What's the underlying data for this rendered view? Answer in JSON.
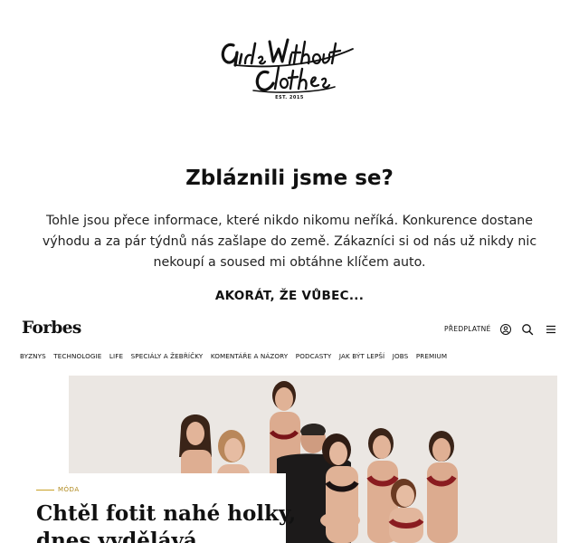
{
  "brand": {
    "logo_text_line1": "Girls Without",
    "logo_text_line2": "Clothes",
    "logo_est": "EST. 2015"
  },
  "intro": {
    "headline": "Zbláznili jsme se?",
    "body": "Tohle jsou přece informace, které nikdo nikomu neříká. Konkurence dostane výhodu a za pár týdnů nás zašlape do země. Zákazníci si od nás už nikdy nic nekoupí a soused mi obtáhne klíčem auto.",
    "cta": "AKORÁT, ŽE VŮBEC..."
  },
  "forbes": {
    "logo": "Forbes",
    "subscribe_label": "PŘEDPLATNÉ",
    "icons": [
      "user-icon",
      "search-icon",
      "menu-icon"
    ],
    "nav": [
      "BYZNYS",
      "TECHNOLOGIE",
      "LIFE",
      "SPECIÁLY A ŽEBŘÍČKY",
      "KOMENTÁŘE A NÁZORY",
      "PODCASTY",
      "JAK BÝT LEPŠÍ",
      "JOBS",
      "PREMIUM"
    ],
    "article": {
      "category": "MÓDA",
      "title": "Chtěl fotit nahé holky, dnes vydělává"
    },
    "accent_color": "#c9a227"
  }
}
